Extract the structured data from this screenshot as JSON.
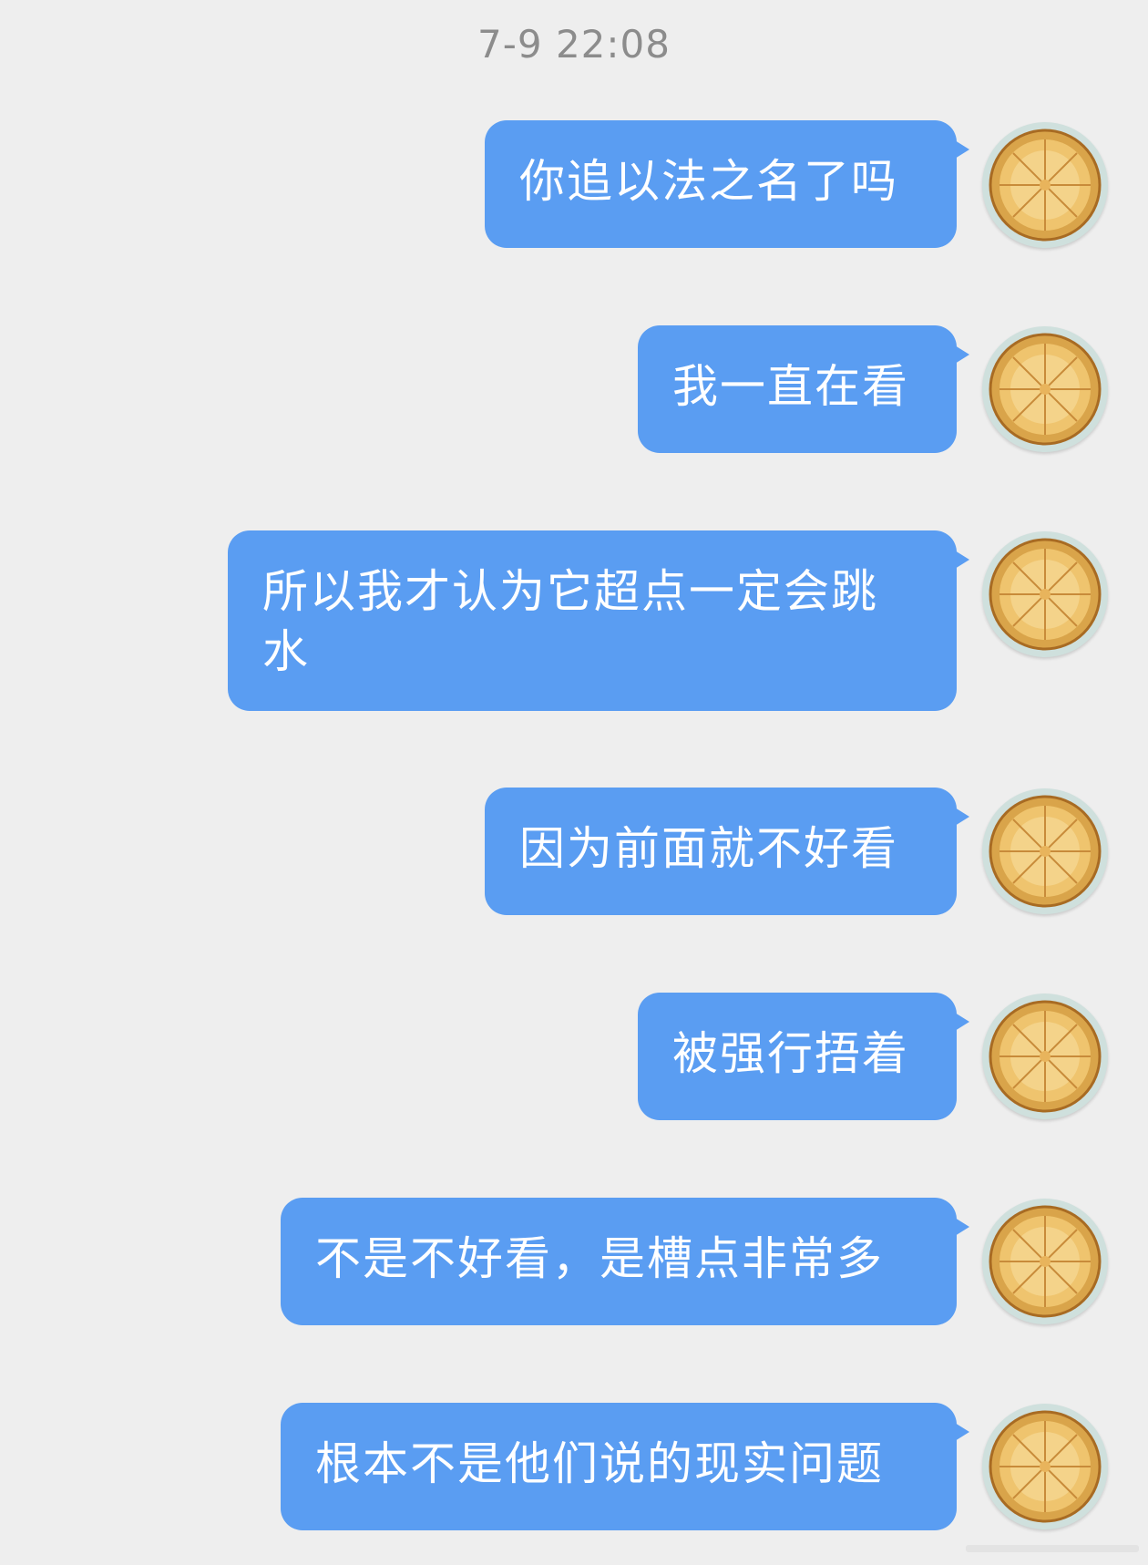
{
  "timestamp": "7-9 22:08",
  "messages": [
    {
      "text": "你追以法之名了吗"
    },
    {
      "text": "我一直在看"
    },
    {
      "text": "所以我才认为它超点一定会跳水"
    },
    {
      "text": "因为前面就不好看"
    },
    {
      "text": "被强行捂着"
    },
    {
      "text": "不是不好看，是槽点非常多"
    },
    {
      "text": "根本不是他们说的现实问题"
    }
  ],
  "colors": {
    "bubble": "#5a9df2",
    "background": "#eeeeee",
    "timestamp": "#8c8c8c"
  },
  "avatar_icon": "pie-icon"
}
